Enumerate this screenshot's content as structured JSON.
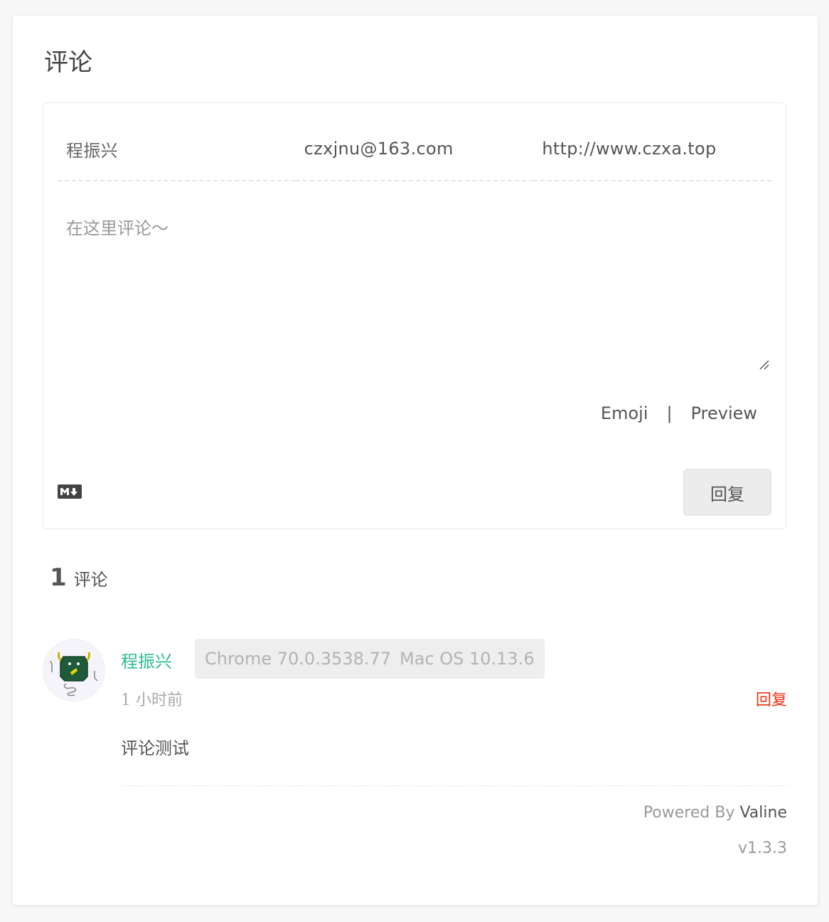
{
  "section_title": "评论",
  "form": {
    "nick_value": "程振兴",
    "mail_value": "czxjnu@163.com",
    "link_value": "http://www.czxa.top",
    "comment_placeholder": "在这里评论～",
    "emoji_label": "Emoji",
    "separator": "|",
    "preview_label": "Preview",
    "markdown_icon": "markdown-icon",
    "submit_label": "回复"
  },
  "summary": {
    "count": "1",
    "count_label": "评论"
  },
  "comments": [
    {
      "nick": "程振兴",
      "browser": "Chrome 70.0.3538.77",
      "os": "Mac OS 10.13.6",
      "time": "1 小时前",
      "reply_label": "回复",
      "content": "评论测试",
      "avatar_icon": "monster-avatar"
    }
  ],
  "footer": {
    "powered_by": "Powered By ",
    "brand": "Valine",
    "version": "v1.3.3"
  },
  "colors": {
    "nick": "#2ebd8f",
    "reply_link": "#ef2f11",
    "badge_bg": "#eeeeee"
  }
}
